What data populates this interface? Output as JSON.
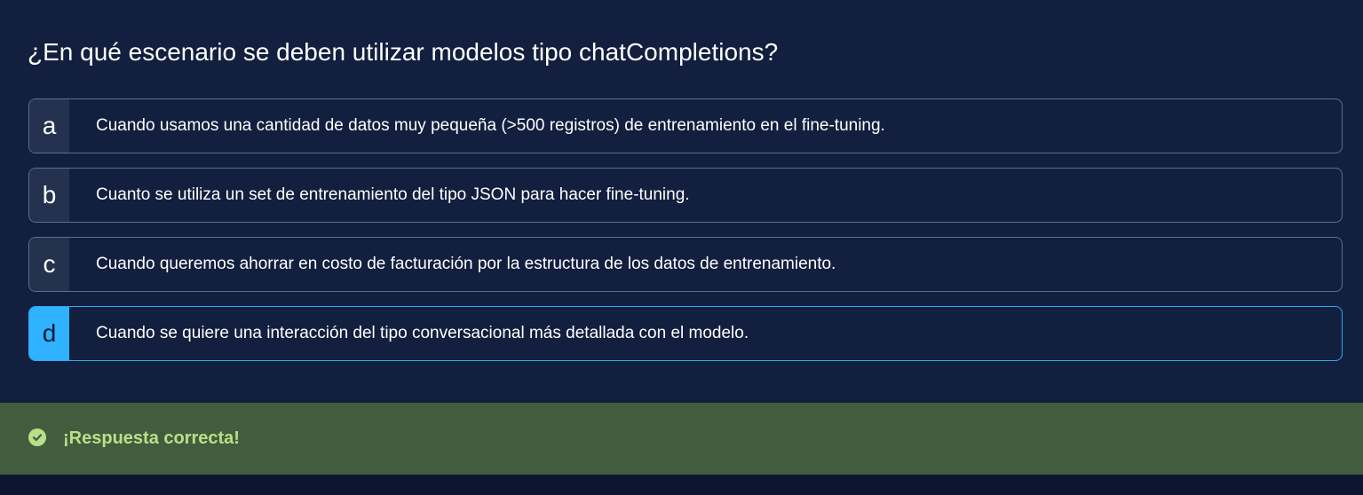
{
  "question": {
    "text": "¿En qué escenario se deben utilizar modelos tipo chatCompletions?"
  },
  "options": [
    {
      "letter": "a",
      "text": "Cuando usamos una cantidad de datos muy pequeña (>500 registros) de entrenamiento en el fine-tuning.",
      "selected": false
    },
    {
      "letter": "b",
      "text": "Cuanto se utiliza un set de entrenamiento del tipo JSON para hacer fine-tuning.",
      "selected": false
    },
    {
      "letter": "c",
      "text": "Cuando queremos ahorrar en costo de facturación por la estructura de los datos de entrenamiento.",
      "selected": false
    },
    {
      "letter": "d",
      "text": "Cuando se quiere una interacción del tipo conversacional más detallada con el modelo.",
      "selected": true
    }
  ],
  "feedback": {
    "icon": "check-circle-icon",
    "message": "¡Respuesta correcta!",
    "color": "#b7e189",
    "background": "#435c3d"
  },
  "colors": {
    "background": "#121f3e",
    "selected_accent": "#2fb2ff",
    "letter_background": "#24314f"
  }
}
